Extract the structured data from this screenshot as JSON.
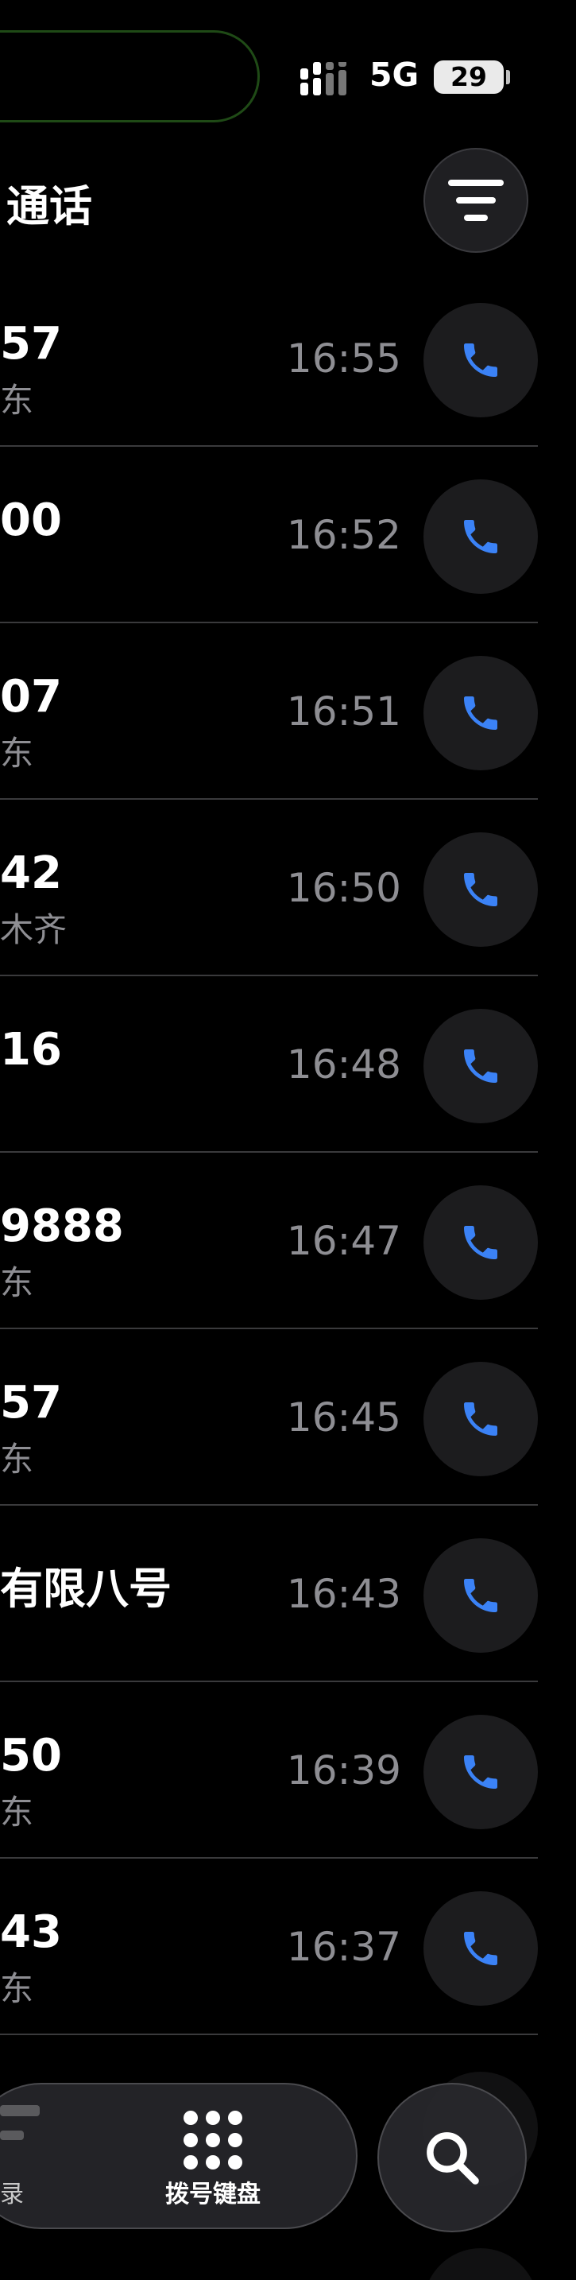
{
  "status_bar": {
    "network": "5G",
    "battery": "29"
  },
  "header": {
    "title": "通话"
  },
  "calls": [
    {
      "number": "57",
      "location": "东",
      "time": "16:55"
    },
    {
      "number": "00",
      "location": "",
      "time": "16:52"
    },
    {
      "number": "07",
      "location": "东",
      "time": "16:51"
    },
    {
      "number": "42",
      "location": "木齐",
      "time": "16:50"
    },
    {
      "number": "16",
      "location": "",
      "time": "16:48"
    },
    {
      "number": "9888",
      "location": "东",
      "time": "16:47"
    },
    {
      "number": "57",
      "location": "东",
      "time": "16:45"
    },
    {
      "number": "有限八号",
      "location": "",
      "time": "16:43"
    },
    {
      "number": "50",
      "location": "东",
      "time": "16:39"
    },
    {
      "number": "43",
      "location": "东",
      "time": "16:37"
    }
  ],
  "bottom_nav": {
    "left_label": "录",
    "dialpad_label": "拨号键盘"
  },
  "colors": {
    "background": "#000000",
    "accent_blue": "#3b82f6",
    "secondary_text": "#8e8e93",
    "button_bg": "#1c1c1e"
  },
  "icons": [
    "signal-icon",
    "filter-icon",
    "phone-icon",
    "dialpad-icon",
    "search-icon"
  ]
}
